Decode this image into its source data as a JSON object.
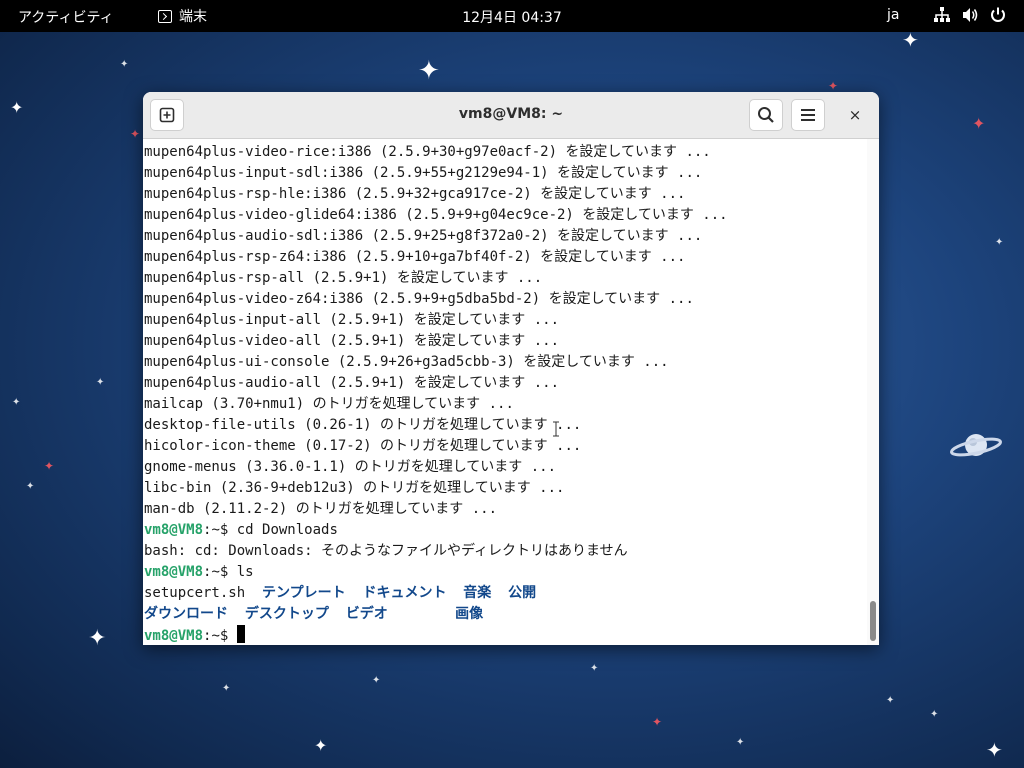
{
  "topbar": {
    "activities": "アクティビティ",
    "app_name": "端末",
    "clock": "12月4日  04:37",
    "input_method": "ja",
    "tray_icons": [
      "network-icon",
      "volume-icon",
      "power-icon"
    ]
  },
  "window": {
    "title": "vm8@VM8: ~",
    "buttons": [
      "new-tab-icon",
      "search-icon",
      "hamburger-menu-icon",
      "close-icon"
    ],
    "close_glyph": "×"
  },
  "terminal": {
    "output_lines": [
      "mupen64plus-video-rice:i386 (2.5.9+30+g97e0acf-2) を設定しています ...",
      "mupen64plus-input-sdl:i386 (2.5.9+55+g2129e94-1) を設定しています ...",
      "mupen64plus-rsp-hle:i386 (2.5.9+32+gca917ce-2) を設定しています ...",
      "mupen64plus-video-glide64:i386 (2.5.9+9+g04ec9ce-2) を設定しています ...",
      "mupen64plus-audio-sdl:i386 (2.5.9+25+g8f372a0-2) を設定しています ...",
      "mupen64plus-rsp-z64:i386 (2.5.9+10+ga7bf40f-2) を設定しています ...",
      "mupen64plus-rsp-all (2.5.9+1) を設定しています ...",
      "mupen64plus-video-z64:i386 (2.5.9+9+g5dba5bd-2) を設定しています ...",
      "mupen64plus-input-all (2.5.9+1) を設定しています ...",
      "mupen64plus-video-all (2.5.9+1) を設定しています ...",
      "mupen64plus-ui-console (2.5.9+26+g3ad5cbb-3) を設定しています ...",
      "mupen64plus-audio-all (2.5.9+1) を設定しています ...",
      "mailcap (3.70+nmu1) のトリガを処理しています ...",
      "desktop-file-utils (0.26-1) のトリガを処理しています ...",
      "hicolor-icon-theme (0.17-2) のトリガを処理しています ...",
      "gnome-menus (3.36.0-1.1) のトリガを処理しています ...",
      "libc-bin (2.36-9+deb12u3) のトリガを処理しています ...",
      "man-db (2.11.2-2) のトリガを処理しています ..."
    ],
    "prompt_user": "vm8@VM8",
    "prompt_suffix": ":~$ ",
    "cmd1": "cd Downloads",
    "error_line": "bash: cd: Downloads: そのようなファイルやディレクトリはありません",
    "cmd2": "ls",
    "ls_row1": {
      "file": "setupcert.sh  ",
      "dirs": "テンプレート  ドキュメント  音楽  公開"
    },
    "ls_row2": {
      "dirs": "ダウンロード  デスクトップ  ビデオ        画像"
    },
    "cmd3": ""
  },
  "colors": {
    "prompt": "#26a269",
    "directory": "#12488b"
  }
}
